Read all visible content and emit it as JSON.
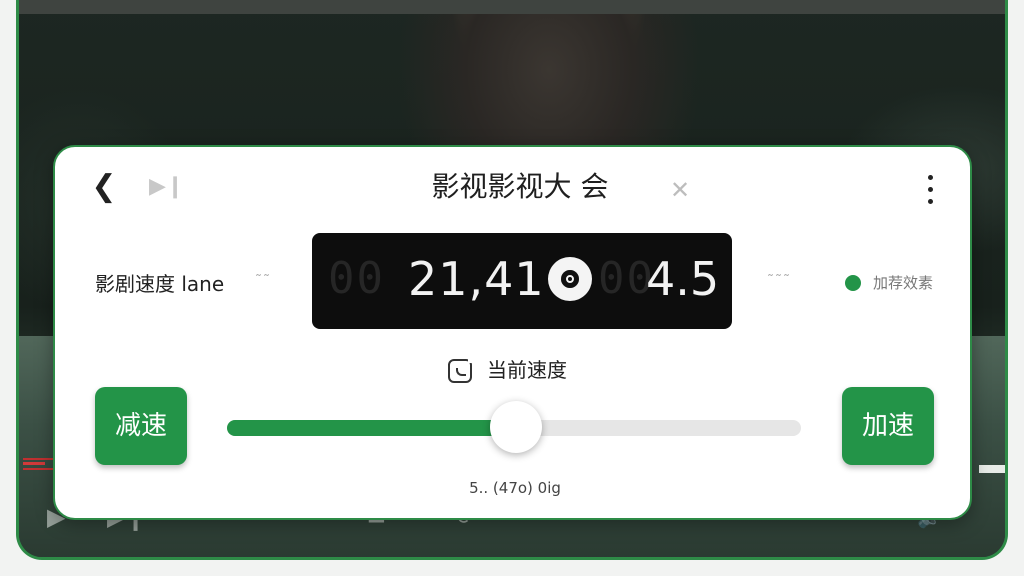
{
  "dialog": {
    "title": "影视影视大 会",
    "back_icon": "chevron-left-icon",
    "play_icon": "play-next-icon",
    "close_icon": "close-icon",
    "more_icon": "more-vertical-icon"
  },
  "speed_row": {
    "label": "影剧速度 lane",
    "dots_left": "˜˜",
    "dots_right": "˜˜˜",
    "display": {
      "ghost_left": "00",
      "main_value": "21,41",
      "ghost_mid": "00",
      "secondary_value": "4.5",
      "badge_icon": "record-icon"
    },
    "status_text": "加荐效素",
    "status_color": "#239448"
  },
  "current_speed": {
    "icon": "capture-icon",
    "label": "当前速度"
  },
  "controls": {
    "decrease_label": "减速",
    "increase_label": "加速",
    "slider_value": 0.5,
    "slider_caption": "5.. (47o) 0ig"
  },
  "colors": {
    "accent": "#239448",
    "frame_border": "#2e8b47",
    "display_bg": "#0d0d0d"
  }
}
